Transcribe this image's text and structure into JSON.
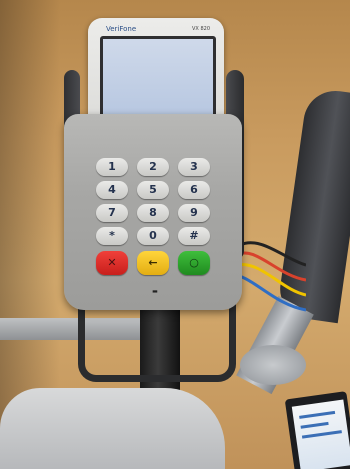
{
  "terminal": {
    "brand": "VeriFone",
    "model": "VX 820"
  },
  "keypad": {
    "keys": [
      "1",
      "2",
      "3",
      "4",
      "5",
      "6",
      "7",
      "8",
      "9",
      "*",
      "0",
      "#",
      "✕",
      "←",
      "○"
    ]
  },
  "colors": {
    "cancel": "#d3221f",
    "clear": "#f1bf1c",
    "enter": "#29a329",
    "shield": "#a7a7a5"
  }
}
